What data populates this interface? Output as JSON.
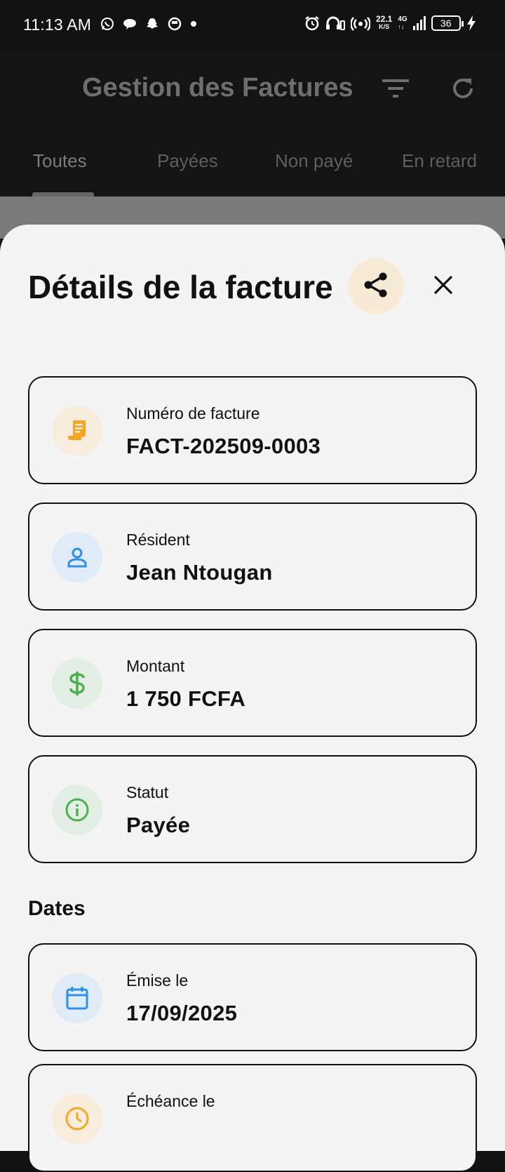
{
  "status_bar": {
    "time": "11:13 AM",
    "speed_value": "22.1",
    "speed_unit": "K/S",
    "network": "4G",
    "battery": "36"
  },
  "app_bar": {
    "title": "Gestion des Factures"
  },
  "tabs": [
    {
      "label": "Toutes",
      "active": true
    },
    {
      "label": "Payées",
      "active": false
    },
    {
      "label": "Non payé",
      "active": false
    },
    {
      "label": "En retard",
      "active": false
    }
  ],
  "sheet": {
    "title": "Détails de la facture",
    "cards": [
      {
        "label": "Numéro de facture",
        "value": "FACT-202509-0003",
        "icon": "receipt-icon",
        "icon_color": "#f5a623",
        "icon_bg": "#f8ecdc"
      },
      {
        "label": "Résident",
        "value": "Jean Ntougan",
        "icon": "person-icon",
        "icon_color": "#2f8fe8",
        "icon_bg": "#dfebf7"
      },
      {
        "label": "Montant",
        "value": "1 750 FCFA",
        "icon": "dollar-icon",
        "icon_color": "#4caf50",
        "icon_bg": "#e3eee4"
      },
      {
        "label": "Statut",
        "value": "Payée",
        "icon": "info-icon",
        "icon_color": "#4caf50",
        "icon_bg": "#e3eee4"
      }
    ],
    "dates_title": "Dates",
    "date_cards": [
      {
        "label": "Émise le",
        "value": "17/09/2025",
        "icon": "calendar-icon",
        "icon_color": "#2f8fe8",
        "icon_bg": "#dfebf7"
      },
      {
        "label": "Échéance le",
        "value": "",
        "icon": "clock-icon",
        "icon_color": "#f5a623",
        "icon_bg": "#f8ecdc"
      }
    ]
  }
}
